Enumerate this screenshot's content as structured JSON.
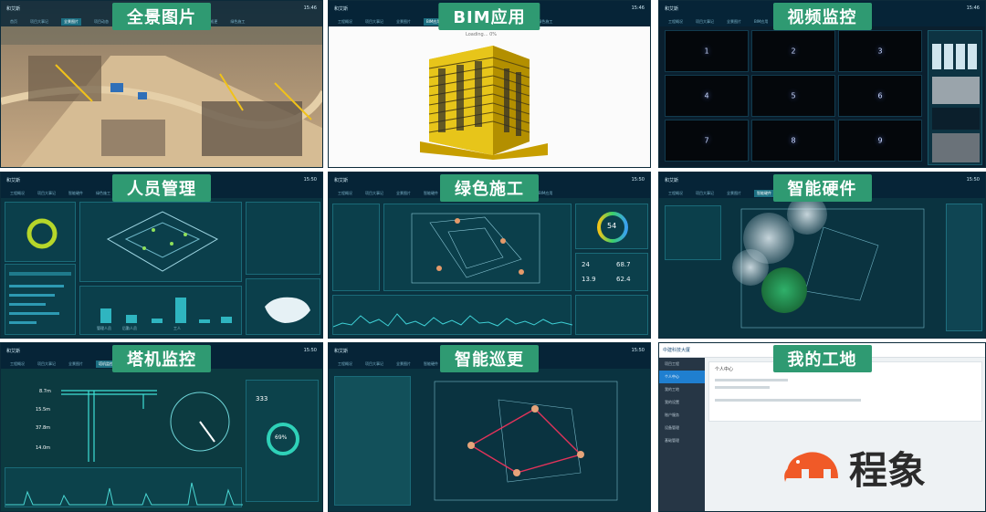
{
  "panels": {
    "panorama": {
      "title": "全景图片",
      "brand": "和艾斯",
      "time": "15:46",
      "nav": [
        "首页",
        "项目大事记",
        "全景图片",
        "项目动态",
        "视频监控",
        "BIM应用",
        "智能硬件",
        "智能巡更",
        "绿色施工"
      ]
    },
    "bim": {
      "title": "BIM应用",
      "brand": "和艾斯",
      "time": "15:46",
      "loading": "Loading... 0%",
      "nav": [
        "工程概况",
        "项目大事记",
        "全景图片",
        "BIM应用",
        "智能硬件",
        "视频监控",
        "智能巡更",
        "绿色施工"
      ]
    },
    "video": {
      "title": "视频监控",
      "brand": "和艾斯",
      "time": "15:46",
      "cameras": [
        "1",
        "2",
        "3",
        "4",
        "5",
        "6",
        "7",
        "8",
        "9"
      ],
      "nav": [
        "工程概况",
        "项目大事记",
        "全景图片",
        "BIM应用",
        "视频监控",
        "智能硬件"
      ]
    },
    "personnel": {
      "title": "人员管理",
      "brand": "和艾斯",
      "time": "15:50",
      "nav": [
        "工程概况",
        "项目大事记",
        "智能硬件",
        "绿色施工",
        "智能巡更",
        "视频监控",
        "BIM应用"
      ],
      "bars": [
        "管理人员",
        "后勤人员",
        "工人",
        "电工",
        "木工",
        "其他"
      ]
    },
    "green": {
      "title": "绿色施工",
      "brand": "和艾斯",
      "time": "15:50",
      "aqi": "54",
      "pm25": "24",
      "pm10": "68.7",
      "temp": "13.9",
      "humidity": "62.4",
      "nav": [
        "工程概况",
        "项目大事记",
        "全景图片",
        "智能硬件",
        "绿色施工",
        "视频监控",
        "智能巡更",
        "BIM应用"
      ]
    },
    "hardware": {
      "title": "智能硬件",
      "brand": "和艾斯",
      "time": "15:50",
      "nav": [
        "工程概况",
        "项目大事记",
        "全景图片",
        "智能硬件",
        "绿色施工",
        "视频监控",
        "BIM应用"
      ]
    },
    "crane": {
      "title": "塔机监控",
      "brand": "和艾斯",
      "time": "15:50",
      "gauge": "333",
      "ratio": "69%",
      "values": [
        "8.7m",
        "15.5m",
        "37.8m",
        "14.0m"
      ],
      "nav": [
        "工程概况",
        "项目大事记",
        "全景图片",
        "塔机监控",
        "智能巡更",
        "视频监控"
      ]
    },
    "patrol": {
      "title": "智能巡更",
      "brand": "和艾斯",
      "time": "15:50",
      "nav": [
        "工程概况",
        "项目大事记",
        "全景图片",
        "智能硬件",
        "智能巡更",
        "视频监控",
        "绿色施工"
      ]
    },
    "mysite": {
      "title": "我的工地",
      "brand": "中建科技大厦",
      "menu": [
        "项目工程",
        "个人中心",
        "我的工地",
        "我的设置",
        "账户服务",
        "设备管理",
        "基础管理"
      ],
      "card_title": "个人中心"
    }
  },
  "watermark": {
    "text": "程象"
  },
  "colors": {
    "title_bg": "#2f9a72",
    "dark_bg": "#0a3340",
    "brand_orange": "#f05a28"
  }
}
